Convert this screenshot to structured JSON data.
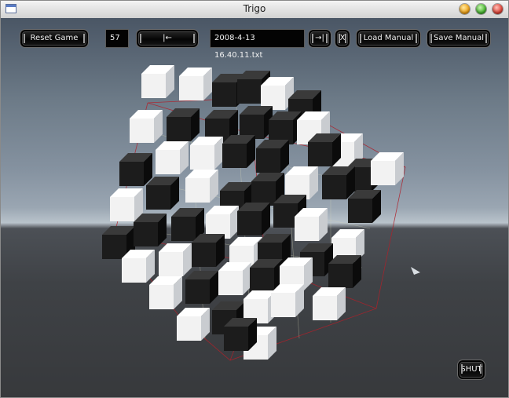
{
  "window": {
    "title": "Trigo"
  },
  "toolbar": {
    "reset_label": "Reset Game",
    "move_count": "57",
    "back_label": "|←",
    "filename": "2008-4-13 16.40.11.txt",
    "jump_end_label": "→|",
    "clear_label": "X",
    "load_label": "Load Manual",
    "save_label": "Save Manual"
  },
  "shut_label": "SHUT",
  "colors": {
    "black_stone": "#1c1c1c",
    "white_stone": "#f2f2f2",
    "frame_line": "#b0202a"
  }
}
